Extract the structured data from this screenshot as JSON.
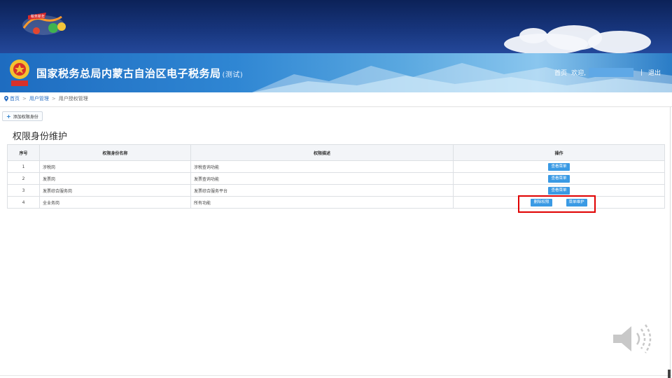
{
  "header": {
    "site_title": "国家税务总局内蒙古自治区电子税务局",
    "site_title_suffix": "(测试)",
    "home_link": "首页",
    "welcome": "欢迎,",
    "separator": "|",
    "logout": "退出"
  },
  "breadcrumb": {
    "home": "首页",
    "user_mgmt": "用户管理",
    "current": "用户授权管理",
    "sep": ">"
  },
  "toolbar": {
    "add_label": "添加权限身份"
  },
  "section_title": "权限身份维护",
  "table": {
    "headers": [
      "序号",
      "权限身份名称",
      "权限描述",
      "操作"
    ],
    "rows": [
      {
        "no": "1",
        "name": "涉税岗",
        "desc": "涉税查询功能",
        "action": "查看菜单"
      },
      {
        "no": "2",
        "name": "发票岗",
        "desc": "发票查询功能",
        "action": "查看菜单"
      },
      {
        "no": "3",
        "name": "发票综合服务岗",
        "desc": "发票综合服务平台",
        "action": "查看菜单"
      },
      {
        "no": "4",
        "name": "全业务岗",
        "desc": "所有功能",
        "action_delete": "删除权限",
        "action_menu": "菜单维护"
      }
    ]
  },
  "colors": {
    "banner_dark": "#0c2258",
    "accent_blue": "#3a9ae4",
    "highlight_red": "#e00000"
  }
}
